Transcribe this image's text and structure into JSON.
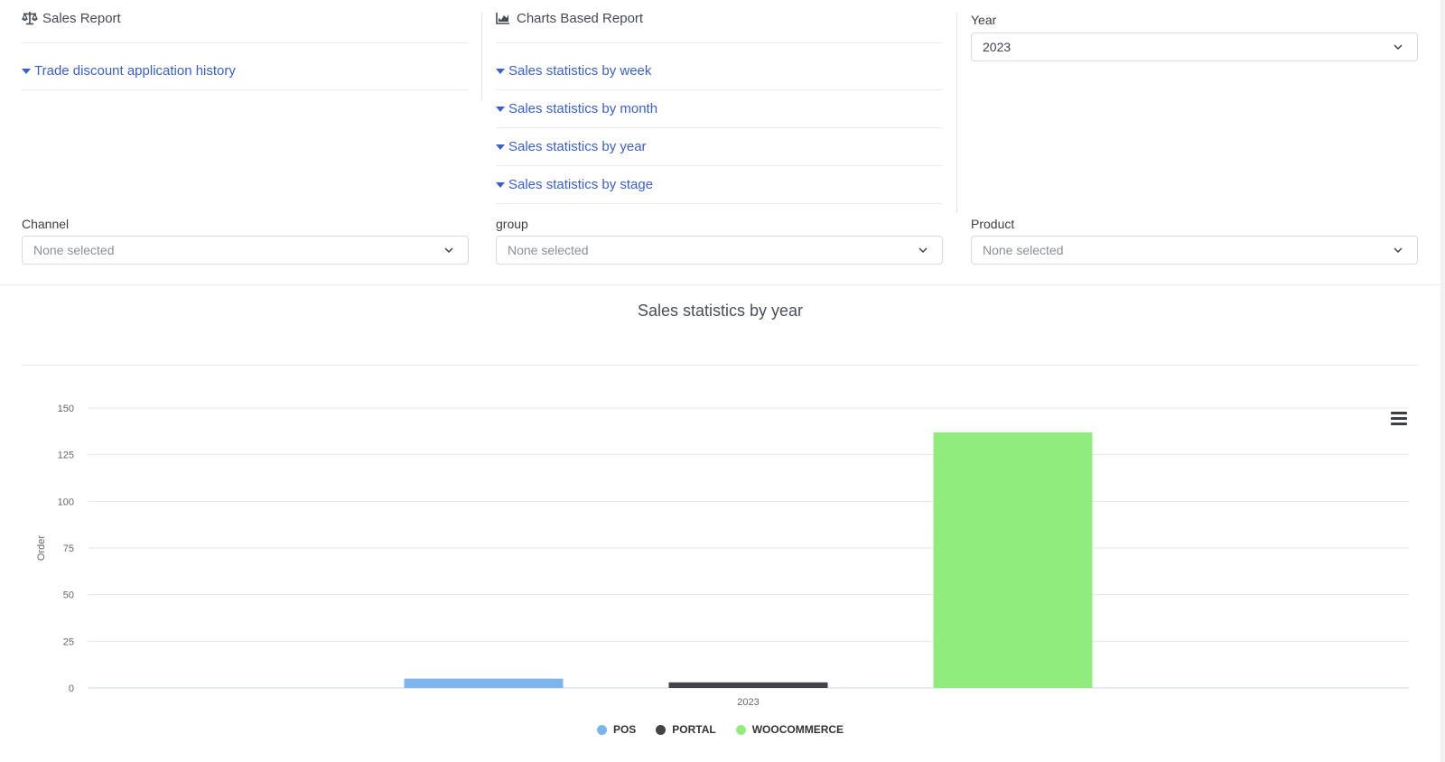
{
  "sales_report": {
    "heading": "Sales Report",
    "icon": "balance-scale-icon",
    "links": [
      "Trade discount application history"
    ]
  },
  "charts_report": {
    "heading": "Charts Based Report",
    "icon": "area-chart-icon",
    "links": [
      "Sales statistics by week",
      "Sales statistics by month",
      "Sales statistics by year",
      "Sales statistics by stage"
    ]
  },
  "filters": {
    "year_label": "Year",
    "year_value": "2023",
    "channel_label": "Channel",
    "channel_value": "None selected",
    "group_label": "group",
    "group_value": "None selected",
    "product_label": "Product",
    "product_value": "None selected"
  },
  "chart_data": {
    "type": "bar",
    "title": "Sales statistics by year",
    "xlabel": "",
    "ylabel": "Order",
    "categories": [
      "2023"
    ],
    "ylim": [
      0,
      150
    ],
    "yticks": [
      0,
      25,
      50,
      75,
      100,
      125,
      150
    ],
    "grid": true,
    "legend_position": "bottom-center",
    "series": [
      {
        "name": "POS",
        "values": [
          5
        ],
        "color": "#7cb5ec"
      },
      {
        "name": "PORTAL",
        "values": [
          3
        ],
        "color": "#434348"
      },
      {
        "name": "WOOCOMMERCE",
        "values": [
          137
        ],
        "color": "#90ed7d"
      }
    ]
  }
}
